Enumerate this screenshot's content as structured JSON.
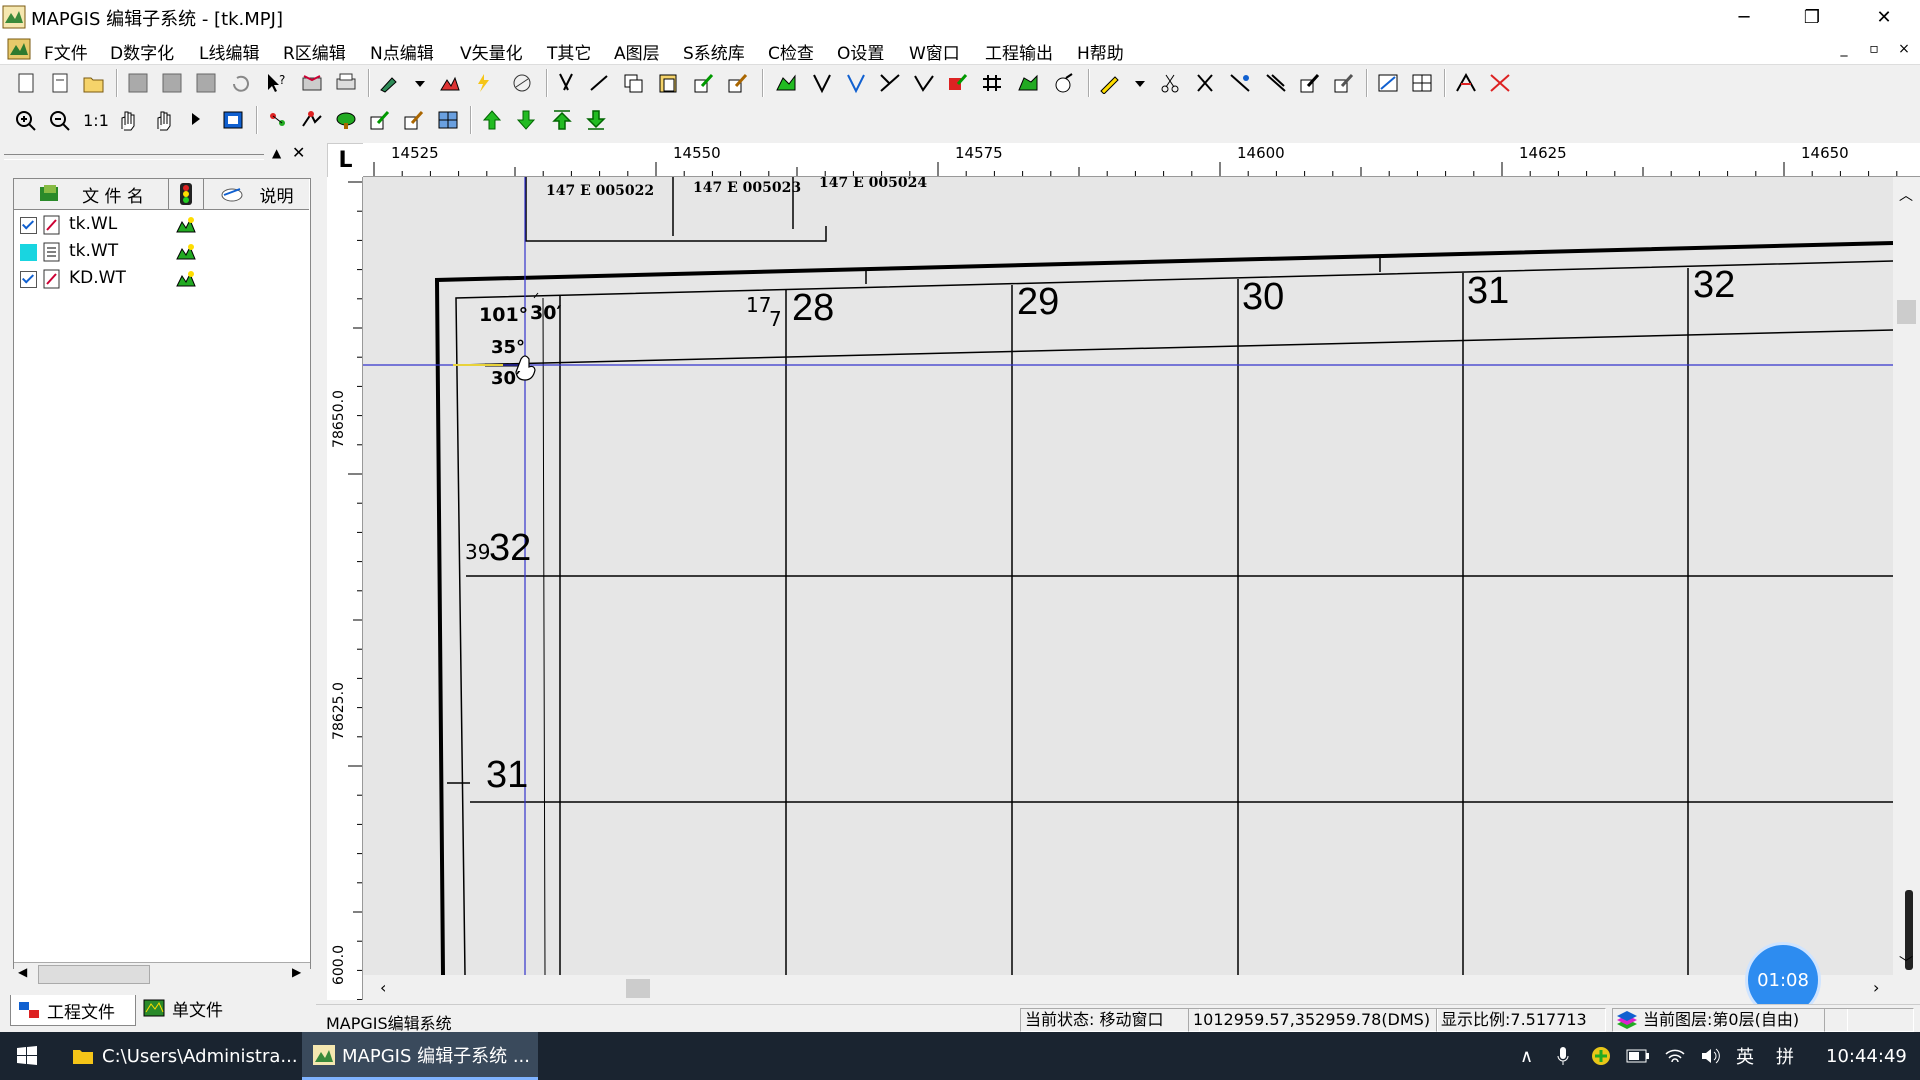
{
  "window": {
    "title": "MAPGIS 编辑子系统 - [tk.MPJ]",
    "minimize": "─",
    "restore": "❐",
    "close": "✕"
  },
  "menu": {
    "items": [
      "F文件",
      "D数字化",
      "L线编辑",
      "R区编辑",
      "N点编辑",
      "V矢量化",
      "T其它",
      "A图层",
      "S系统库",
      "C检查",
      "O设置",
      "W窗口",
      "工程输出",
      "H帮助"
    ],
    "mdi": {
      "min": "_",
      "restore": "▫",
      "close": "×"
    }
  },
  "left_panel": {
    "columns": {
      "filename": "文 件 名",
      "note": "说明"
    },
    "files": [
      {
        "name": "tk.WL",
        "checked": true
      },
      {
        "name": "tk.WT",
        "checked": false
      },
      {
        "name": "KD.WT",
        "checked": true
      }
    ],
    "tabs": {
      "project": "工程文件",
      "single": "单文件"
    }
  },
  "rulers": {
    "corner": "L",
    "h_labels": [
      "14525",
      "14550",
      "14575",
      "14600",
      "14625",
      "14650"
    ],
    "v_labels": [
      "78650.0",
      "78625.0",
      "600.0"
    ]
  },
  "map": {
    "sheet_ids": [
      "147 E 005022",
      "147 E 005023",
      "147 E 005024"
    ],
    "top_numbers": [
      "28",
      "29",
      "30",
      "31",
      "32"
    ],
    "corner_labels": {
      "lon_deg": "101°",
      "lon_min": "30′",
      "lat_deg": "35°",
      "lat_min": "30′",
      "small_17": "17",
      "small_7": "7"
    },
    "left_numbers": {
      "small_39": "39",
      "n32": "32",
      "n31": "31"
    }
  },
  "status": {
    "app_name": "MAPGIS编辑系统",
    "state": "当前状态: 移动窗口",
    "coords": "1012959.57,352959.78(DMS)",
    "scale": "显示比例:7.517713",
    "layer": "当前图层:第0层(自由)"
  },
  "timer": "01:08",
  "taskbar": {
    "explorer": "C:\\Users\\Administra...",
    "mapgis": "MAPGIS 编辑子系统 ...",
    "ime": "英",
    "ime2": "拼",
    "time": "10:44:49"
  },
  "colors": {
    "crosshair": "#3333cc",
    "timer_bg": "#2d8cf0",
    "taskbar": "#1a2430"
  }
}
